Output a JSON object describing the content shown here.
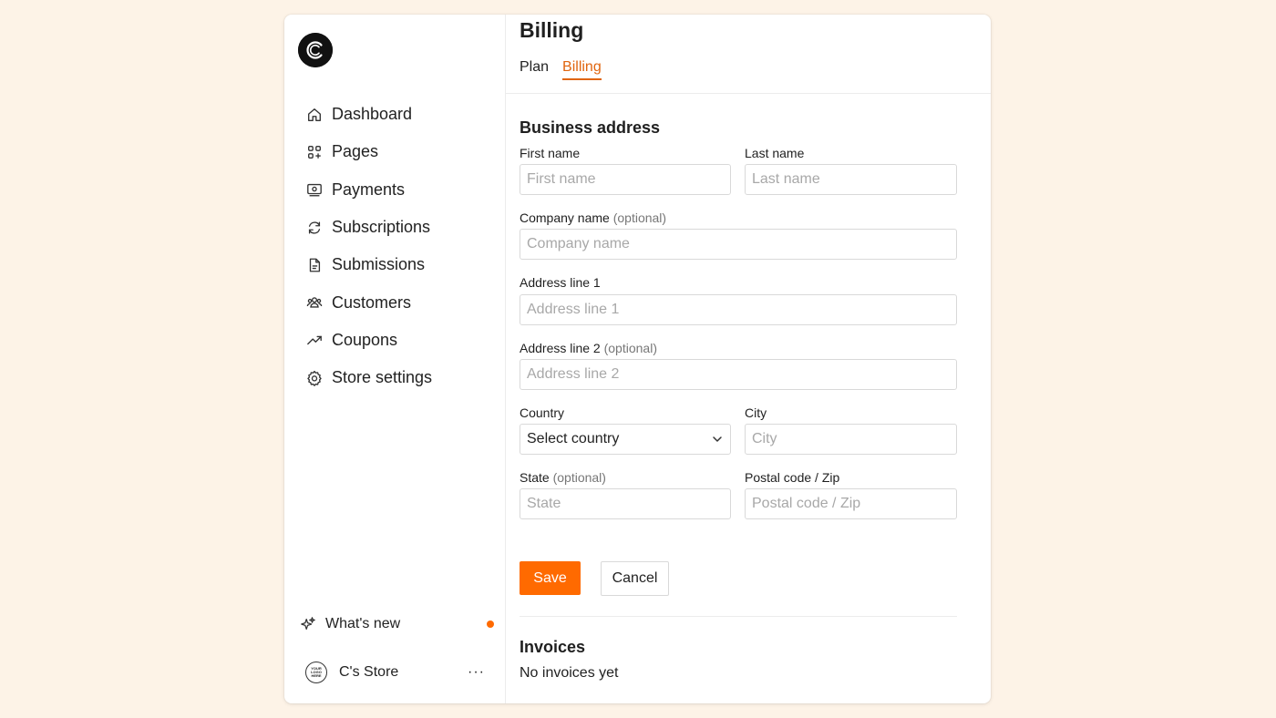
{
  "sidebar": {
    "logo_icon": "circle-c-logo-icon",
    "items": [
      {
        "label": "Dashboard",
        "icon": "home-icon"
      },
      {
        "label": "Pages",
        "icon": "pages-icon"
      },
      {
        "label": "Payments",
        "icon": "banknote-icon"
      },
      {
        "label": "Subscriptions",
        "icon": "refresh-icon"
      },
      {
        "label": "Submissions",
        "icon": "document-icon"
      },
      {
        "label": "Customers",
        "icon": "users-icon"
      },
      {
        "label": "Coupons",
        "icon": "trending-up-icon"
      },
      {
        "label": "Store settings",
        "icon": "gear-icon"
      }
    ],
    "whats_new": {
      "label": "What's new",
      "icon": "sparkles-icon",
      "badge_color": "#ff6a00"
    },
    "store": {
      "name": "C's Store",
      "avatar_text": "YOUR LOGO HERE",
      "more": "···"
    }
  },
  "header": {
    "title": "Billing",
    "tabs": [
      {
        "label": "Plan",
        "active": false
      },
      {
        "label": "Billing",
        "active": true
      }
    ]
  },
  "form": {
    "section_title": "Business address",
    "first_name": {
      "label": "First name",
      "placeholder": "First name",
      "value": ""
    },
    "last_name": {
      "label": "Last name",
      "placeholder": "Last name",
      "value": ""
    },
    "company_name": {
      "label": "Company name",
      "optional": "(optional)",
      "placeholder": "Company name",
      "value": ""
    },
    "address_line_1": {
      "label": "Address line 1",
      "placeholder": "Address line 1",
      "value": ""
    },
    "address_line_2": {
      "label": "Address line 2",
      "optional": "(optional)",
      "placeholder": "Address line 2",
      "value": ""
    },
    "country": {
      "label": "Country",
      "selected": "Select country"
    },
    "city": {
      "label": "City",
      "placeholder": "City",
      "value": ""
    },
    "state": {
      "label": "State",
      "optional": "(optional)",
      "placeholder": "State",
      "value": ""
    },
    "postal_code": {
      "label": "Postal code / Zip",
      "placeholder": "Postal code / Zip",
      "value": ""
    },
    "save_label": "Save",
    "cancel_label": "Cancel"
  },
  "invoices": {
    "title": "Invoices",
    "empty_text": "No invoices yet"
  },
  "colors": {
    "accent": "#ff6a00",
    "active_tab": "#e0650f",
    "background": "#fdf3e7"
  }
}
